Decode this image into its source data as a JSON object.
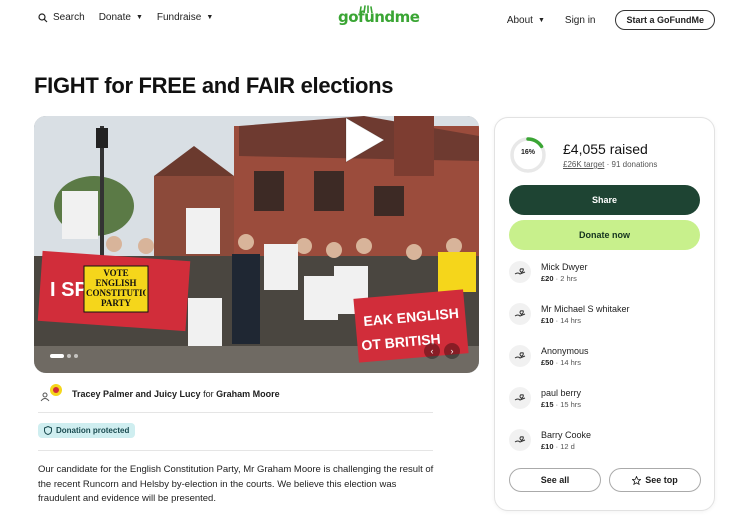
{
  "nav": {
    "search_label": "Search",
    "donate_label": "Donate",
    "fundraise_label": "Fundraise",
    "logo_text": "gofundme",
    "about_label": "About",
    "signin_label": "Sign in",
    "start_label": "Start a GoFundMe"
  },
  "campaign": {
    "title": "FIGHT for FREE and FAIR elections",
    "organizer_names": "Tracey Palmer and Juicy Lucy",
    "organizer_for": "for",
    "beneficiary": "Graham Moore",
    "protected_label": "Donation protected",
    "description": "Our candidate for the English Constitution Party, Mr Graham Moore is challenging the result of the recent Runcorn and Helsby by-election in the courts. We believe this election was fraudulent and evidence will be presented."
  },
  "media": {
    "sign_vote": "VOTE ENGLISH CONSTITUTION PARTY",
    "sign_speak": "EAK ENGLISH",
    "sign_not": "OT BRITISH",
    "sign_left": "I SP",
    "progress_percent": 0.16
  },
  "donation": {
    "progress_label": "16%",
    "raised": "£4,055 raised",
    "target": "£26K target",
    "separator": "·",
    "donations": "91 donations",
    "share_label": "Share",
    "donate_label": "Donate now",
    "donors": [
      {
        "name": "Mick Dwyer",
        "amount": "£20",
        "time": "2 hrs"
      },
      {
        "name": "Mr Michael S whitaker",
        "amount": "£10",
        "time": "14 hrs"
      },
      {
        "name": "Anonymous",
        "amount": "£50",
        "time": "14 hrs"
      },
      {
        "name": "paul berry",
        "amount": "£15",
        "time": "15 hrs"
      },
      {
        "name": "Barry Cooke",
        "amount": "£10",
        "time": "12 d"
      }
    ],
    "see_all_label": "See all",
    "see_top_label": "See top"
  },
  "colors": {
    "brand_green": "#3aa534",
    "share_bg": "#1e4433",
    "donate_bg": "#c8f08c",
    "protected_bg": "#cfeef0"
  }
}
